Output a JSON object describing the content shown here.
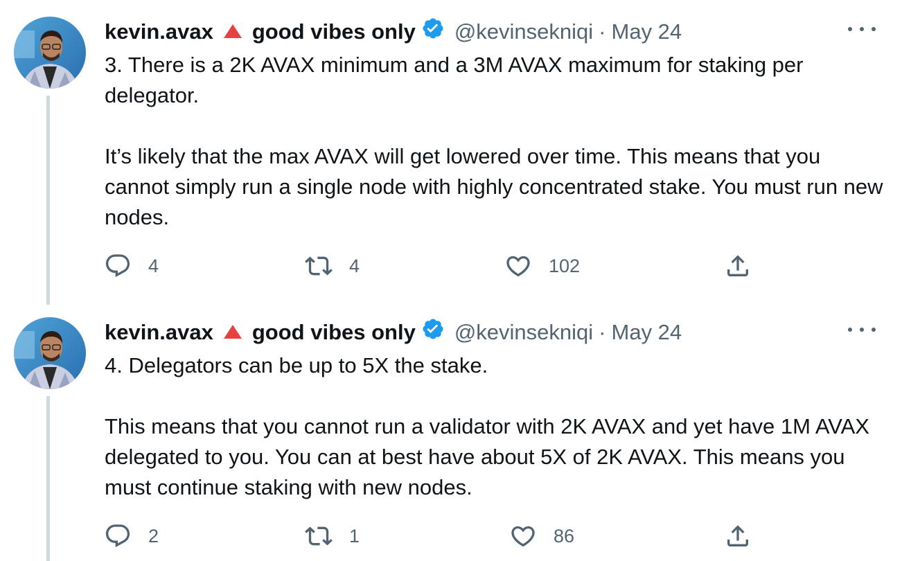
{
  "tweets": [
    {
      "display_name": "kevin.avax",
      "display_suffix": "good vibes only",
      "handle": "@kevinsekniqi",
      "separator": "·",
      "date": "May 24",
      "paragraphs": [
        "3. There is a 2K AVAX minimum and a 3M AVAX maximum for staking per delegator.",
        "It’s likely that the max AVAX will get lowered over time. This means that you cannot simply run a single node with highly concentrated stake. You must run new nodes."
      ],
      "replies": "4",
      "retweets": "4",
      "likes": "102"
    },
    {
      "display_name": "kevin.avax",
      "display_suffix": "good vibes only",
      "handle": "@kevinsekniqi",
      "separator": "·",
      "date": "May 24",
      "paragraphs": [
        "4. Delegators can be up to 5X the stake.",
        "This means that you cannot run a validator with 2K AVAX and yet have 1M AVAX delegated to you. You can at best have about 5X of 2K AVAX. This means you must continue staking with new nodes."
      ],
      "replies": "2",
      "retweets": "1",
      "likes": "86"
    }
  ],
  "colors": {
    "text": "#0f1419",
    "secondary": "#536471",
    "verified": "#1d9bf0",
    "avalanche_red": "#e84142",
    "thread_line": "#cfd9de"
  },
  "icons": [
    "avalanche-triangle-icon",
    "verified-badge-icon",
    "more-icon",
    "reply-icon",
    "retweet-icon",
    "like-icon",
    "share-icon"
  ]
}
